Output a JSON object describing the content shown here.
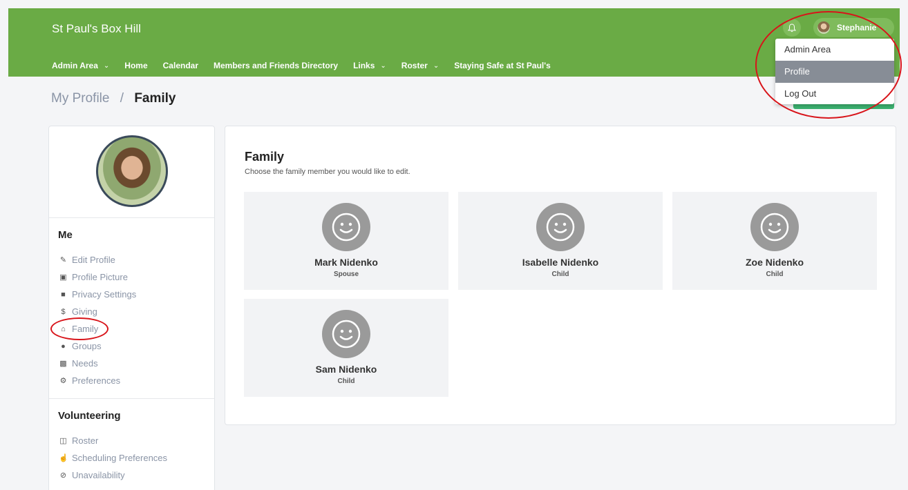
{
  "header": {
    "site_title": "St Paul's Box Hill",
    "nav": [
      {
        "label": "Admin Area",
        "has_dropdown": true
      },
      {
        "label": "Home",
        "has_dropdown": false
      },
      {
        "label": "Calendar",
        "has_dropdown": false
      },
      {
        "label": "Members and Friends Directory",
        "has_dropdown": false
      },
      {
        "label": "Links",
        "has_dropdown": true
      },
      {
        "label": "Roster",
        "has_dropdown": true
      },
      {
        "label": "Staying Safe at St Paul's",
        "has_dropdown": false
      }
    ],
    "user_name": "Stephanie",
    "bell_icon": "bell-icon",
    "colors": {
      "brand": "#6aab45"
    }
  },
  "user_menu": {
    "items": [
      {
        "label": "Admin Area",
        "active": false
      },
      {
        "label": "Profile",
        "active": true
      },
      {
        "label": "Log Out",
        "active": false
      }
    ]
  },
  "breadcrumb": {
    "parent": "My Profile",
    "separator": "/",
    "current": "Family"
  },
  "sidebar": {
    "me_heading": "Me",
    "me_items": [
      {
        "label": "Edit Profile",
        "icon": "pencil-icon"
      },
      {
        "label": "Profile Picture",
        "icon": "picture-icon"
      },
      {
        "label": "Privacy Settings",
        "icon": "lock-icon"
      },
      {
        "label": "Giving",
        "icon": "dollar-icon"
      },
      {
        "label": "Family",
        "icon": "home-icon"
      },
      {
        "label": "Groups",
        "icon": "users-icon"
      },
      {
        "label": "Needs",
        "icon": "gift-icon"
      },
      {
        "label": "Preferences",
        "icon": "gear-icon"
      }
    ],
    "volunteering_heading": "Volunteering",
    "volunteering_items": [
      {
        "label": "Roster",
        "icon": "calendar-icon"
      },
      {
        "label": "Scheduling Preferences",
        "icon": "thumbs-up-icon"
      },
      {
        "label": "Unavailability",
        "icon": "ban-icon"
      }
    ]
  },
  "main": {
    "title": "Family",
    "subtitle": "Choose the family member you would like to edit.",
    "members": [
      {
        "name": "Mark Nidenko",
        "role": "Spouse"
      },
      {
        "name": "Isabelle Nidenko",
        "role": "Child"
      },
      {
        "name": "Zoe Nidenko",
        "role": "Child"
      },
      {
        "name": "Sam Nidenko",
        "role": "Child"
      }
    ]
  }
}
